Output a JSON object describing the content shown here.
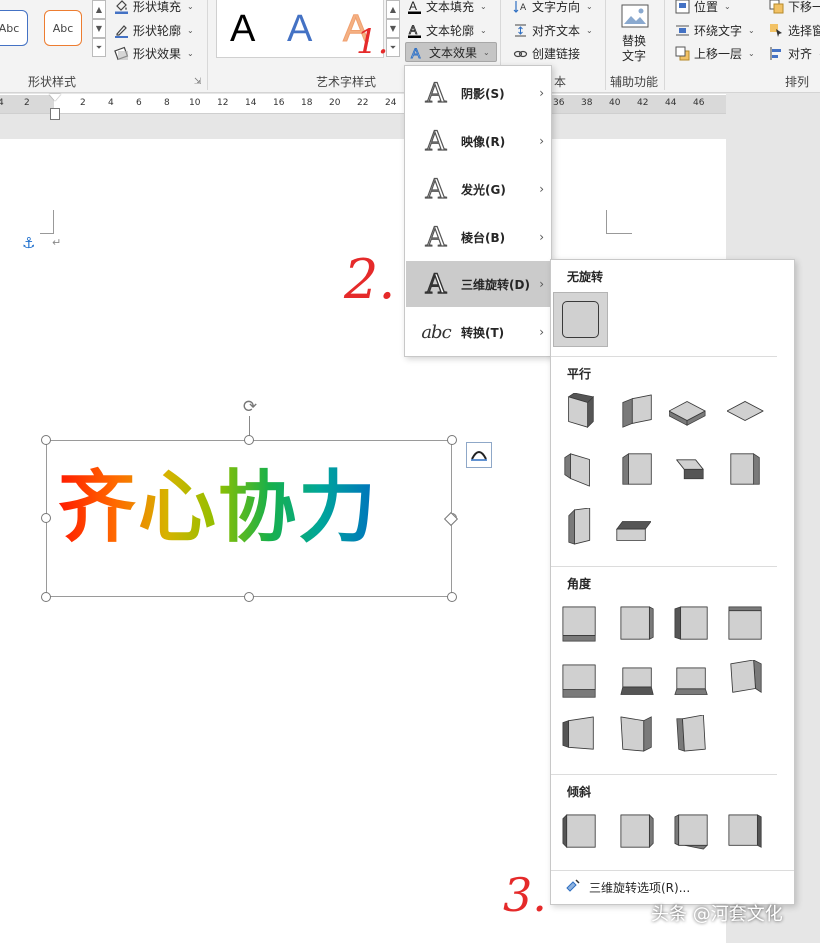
{
  "ribbon": {
    "shape_styles": {
      "abc_samples": [
        "Abc",
        "Abc"
      ],
      "items": [
        {
          "label": "形状填充",
          "icon": "paint-bucket-icon"
        },
        {
          "label": "形状轮廓",
          "icon": "pen-outline-icon"
        },
        {
          "label": "形状效果",
          "icon": "shape-effects-icon"
        }
      ],
      "group_label": "形状样式"
    },
    "wordart_styles": {
      "samples": [
        "A",
        "A",
        "A"
      ],
      "items": [
        {
          "label": "文本填充",
          "icon": "text-fill-icon"
        },
        {
          "label": "文本轮廓",
          "icon": "text-outline-icon"
        },
        {
          "label": "文本效果",
          "icon": "text-effects-icon"
        }
      ],
      "group_label": "艺术字样式"
    },
    "text": {
      "items": [
        {
          "label": "文字方向",
          "icon": "text-direction-icon"
        },
        {
          "label": "对齐文本",
          "icon": "align-text-icon"
        },
        {
          "label": "创建链接",
          "icon": "link-icon"
        }
      ],
      "group_label_partial": "本"
    },
    "accessibility": {
      "button_label_line1": "替换",
      "button_label_line2": "文字",
      "group_label": "辅助功能"
    },
    "arrange": {
      "col1": [
        {
          "label": "位置",
          "icon": "position-icon"
        },
        {
          "label": "环绕文字",
          "icon": "wrap-text-icon"
        },
        {
          "label": "上移一层",
          "icon": "bring-forward-icon"
        }
      ],
      "col2": [
        {
          "label": "下移一",
          "icon": "send-backward-icon"
        },
        {
          "label": "选择窗",
          "icon": "selection-pane-icon"
        },
        {
          "label": "对齐",
          "icon": "align-icon"
        }
      ],
      "group_label": "排列"
    }
  },
  "ruler": {
    "ticks": [
      "4",
      "2",
      "2",
      "4",
      "6",
      "8",
      "10",
      "12",
      "14",
      "16",
      "18",
      "20",
      "22",
      "24",
      "36",
      "38",
      "40",
      "42",
      "44",
      "46"
    ]
  },
  "document": {
    "wordart_text": "齐心协力"
  },
  "text_effects_menu": {
    "items": [
      {
        "label": "阴影(S)",
        "icon": "shadow-a-icon"
      },
      {
        "label": "映像(R)",
        "icon": "reflection-a-icon"
      },
      {
        "label": "发光(G)",
        "icon": "glow-a-icon"
      },
      {
        "label": "棱台(B)",
        "icon": "bevel-a-icon"
      },
      {
        "label": "三维旋转(D)",
        "icon": "3d-rotation-a-icon",
        "active": true
      },
      {
        "label": "转换(T)",
        "icon": "transform-abc-icon"
      }
    ],
    "icon_glyph": "A",
    "abc_glyph": "abc"
  },
  "rotation_gallery": {
    "sections": [
      {
        "title": "无旋转",
        "count": 1
      },
      {
        "title": "平行",
        "count": 10
      },
      {
        "title": "角度",
        "count": 11
      },
      {
        "title": "倾斜",
        "count": 4
      }
    ],
    "options_label": "三维旋转选项(R)..."
  },
  "annotations": {
    "step1": "1.",
    "step2": "2.",
    "step3": "3."
  },
  "watermark": "头条 @河套文化"
}
